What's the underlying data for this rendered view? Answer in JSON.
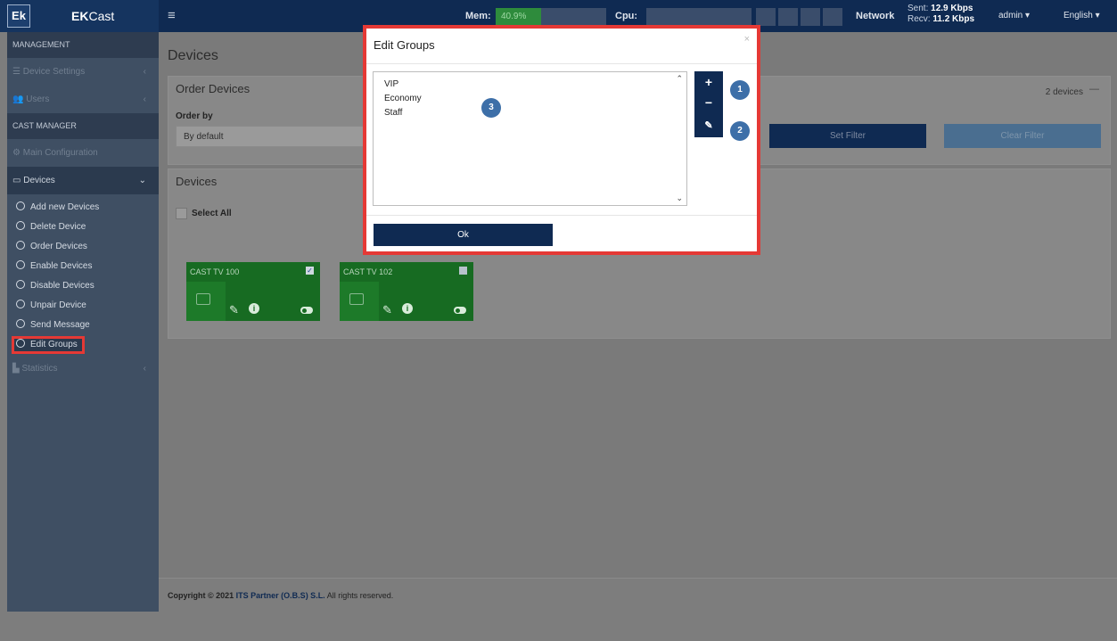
{
  "brand": {
    "logo": "Ek",
    "name_bold": "EK",
    "name_rest": "Cast"
  },
  "topbar": {
    "menu_icon": "menu-icon",
    "mem_label": "Mem:",
    "mem_value": "40.9%",
    "mem_fraction": 0.409,
    "cpu_label": "Cpu:",
    "network_label": "Network",
    "sent_label": "Sent:",
    "sent_value": "12.9 Kbps",
    "recv_label": "Recv:",
    "recv_value": "11.2 Kbps",
    "user": "admin",
    "language": "English"
  },
  "sidebar": {
    "section_management": "MANAGEMENT",
    "device_settings": "Device Settings",
    "users": "Users",
    "section_cast": "CAST MANAGER",
    "main_config": "Main Configuration",
    "devices": "Devices",
    "sub_items": [
      "Add new Devices",
      "Delete Device",
      "Order Devices",
      "Enable Devices",
      "Disable Devices",
      "Unpair Device",
      "Send Message",
      "Edit Groups"
    ],
    "statistics": "Statistics"
  },
  "main": {
    "page_title": "Devices",
    "order_panel": {
      "title": "Order Devices",
      "order_by_label": "Order by",
      "order_by_value": "By default",
      "device_count": "2 devices",
      "set_filter": "Set Filter",
      "clear_filter": "Clear Filter"
    },
    "devices_panel": {
      "title": "Devices",
      "select_all": "Select All",
      "devices": [
        {
          "name": "CAST TV 100",
          "checked": true
        },
        {
          "name": "CAST TV 102",
          "checked": false
        }
      ]
    }
  },
  "footer": {
    "prefix": "Copyright © 2021",
    "company": "ITS Partner (O.B.S) S.L.",
    "suffix": "All rights reserved."
  },
  "modal": {
    "title": "Edit Groups",
    "close": "×",
    "groups": [
      "VIP",
      "Economy",
      "Staff"
    ],
    "add_label": "+",
    "remove_label": "−",
    "ok_label": "Ok",
    "badges": [
      "1",
      "2",
      "3"
    ]
  },
  "colors": {
    "accent": "#0f2a52",
    "highlight": "#e53935",
    "device_green": "#176b22",
    "badge": "#3d6fa8"
  }
}
